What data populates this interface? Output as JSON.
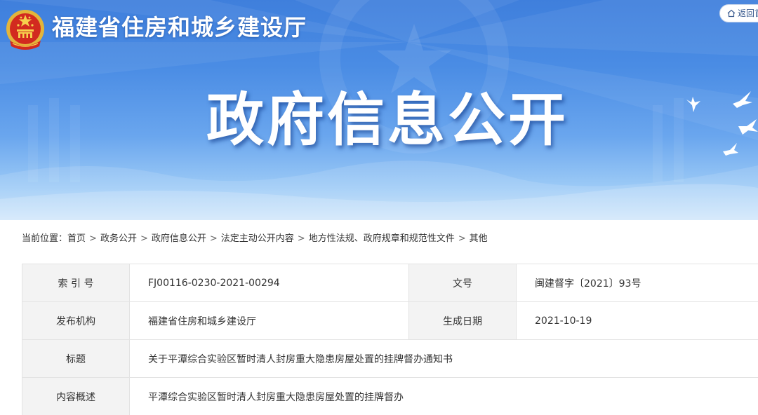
{
  "header": {
    "site_title": "福建省住房和城乡建设厅",
    "back_label": "返回首页",
    "hero_title": "政府信息公开"
  },
  "breadcrumb": {
    "prefix": "当前位置：",
    "items": [
      "首页",
      "政务公开",
      "政府信息公开",
      "法定主动公开内容",
      "地方性法规、政府规章和规范性文件",
      "其他"
    ],
    "separator": ">"
  },
  "info": {
    "index_label": "索 引 号",
    "index_value": "FJ00116-0230-2021-00294",
    "doc_no_label": "文号",
    "doc_no_value": "闽建督字〔2021〕93号",
    "publisher_label": "发布机构",
    "publisher_value": "福建省住房和城乡建设厅",
    "date_label": "生成日期",
    "date_value": "2021-10-19",
    "title_label": "标题",
    "title_value": "关于平潭综合实验区暂时清人封房重大隐患房屋处置的挂牌督办通知书",
    "summary_label": "内容概述",
    "summary_value": "平潭综合实验区暂时清人封房重大隐患房屋处置的挂牌督办"
  },
  "colors": {
    "banner_top": "#3f7fdc",
    "banner_bottom": "#c9e3fb",
    "label_cell_bg": "#f3f3f3",
    "table_border": "#e3e3e3",
    "text": "#333333"
  }
}
